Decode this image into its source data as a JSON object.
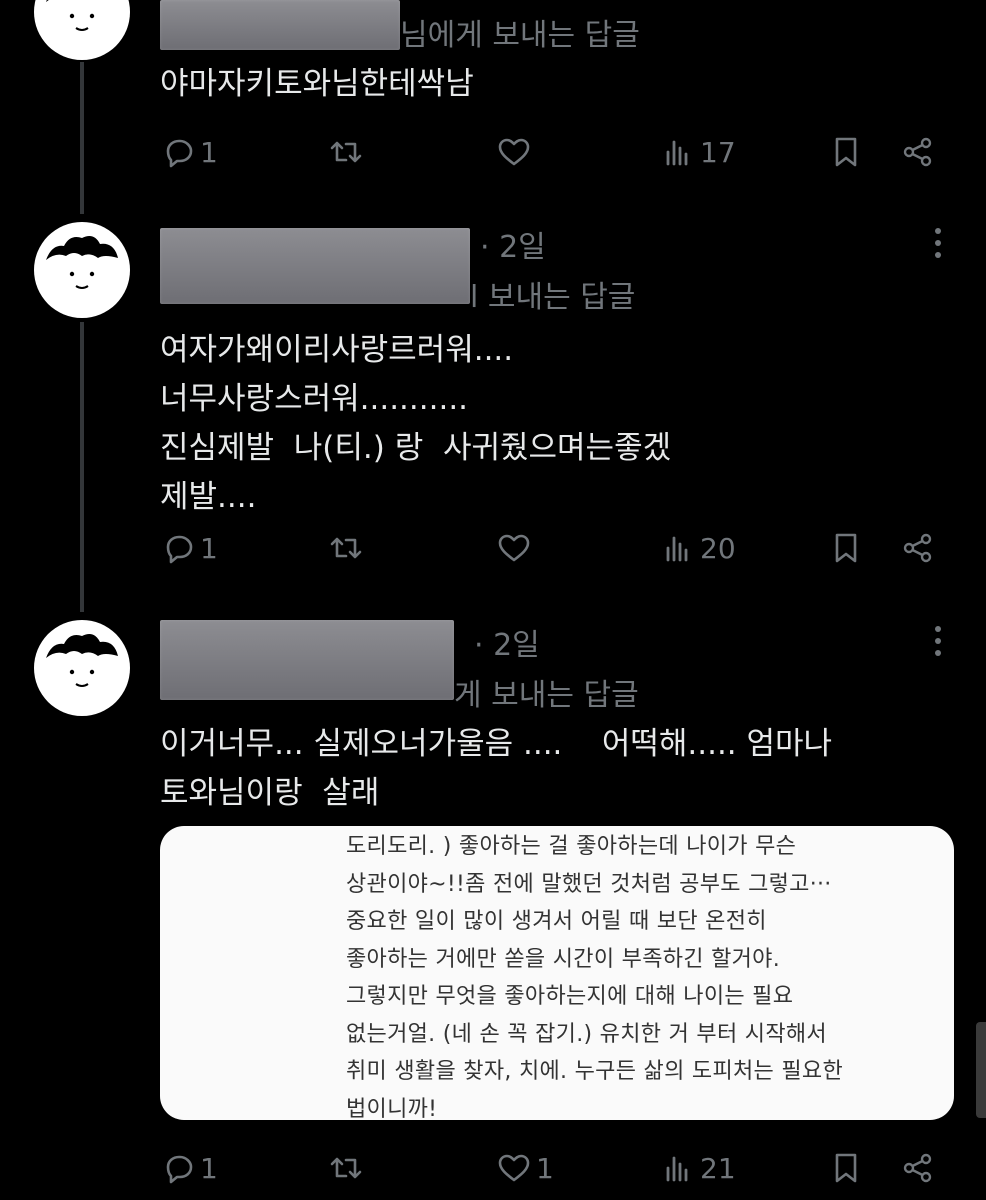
{
  "tweets": [
    {
      "replying_to": "님에게 보내는 답글",
      "text": "야마자키토와님한테싹남",
      "actions": {
        "replies": "1",
        "retweets": "",
        "likes": "",
        "views": "17"
      }
    },
    {
      "meta_time": "· 2일",
      "replying_to": "l 보내는 답글",
      "text": "여자가왜이리사랑르러워....\n너무사랑스러워...........\n진심제발  나(티.) 랑  사귀줬으며는좋겠\n제발....",
      "actions": {
        "replies": "1",
        "retweets": "",
        "likes": "",
        "views": "20"
      }
    },
    {
      "meta_time": "· 2일",
      "replying_to": "게 보내는 답글",
      "text": "이거너무... 실제오너가울음 ....    어떡해..... 엄마나\n토와님이랑  살래",
      "embedded_image_text": "도리도리. ) 좋아하는 걸 좋아하는데 나이가 무슨\n상관이야~!!좀 전에 말했던 것처럼 공부도 그렇고···\n중요한 일이 많이 생겨서 어릴 때 보단 온전히\n좋아하는 거에만 쏟을 시간이 부족하긴 할거야.\n그렇지만 무엇을 좋아하는지에 대해 나이는 필요\n없는거얼. (네 손 꼭 잡기.) 유치한 거 부터 시작해서\n취미 생활을 찾자, 치에. 누구든 삶의 도피처는 필요한\n법이니까!",
      "actions": {
        "replies": "1",
        "retweets": "",
        "likes": "1",
        "views": "21"
      }
    }
  ],
  "colors": {
    "background": "#000000",
    "text": "#e7e9ea",
    "muted": "#71767b",
    "thread_line": "#333639"
  },
  "icons": [
    "reply-icon",
    "retweet-icon",
    "like-icon",
    "views-icon",
    "bookmark-icon",
    "share-icon",
    "more-icon"
  ]
}
